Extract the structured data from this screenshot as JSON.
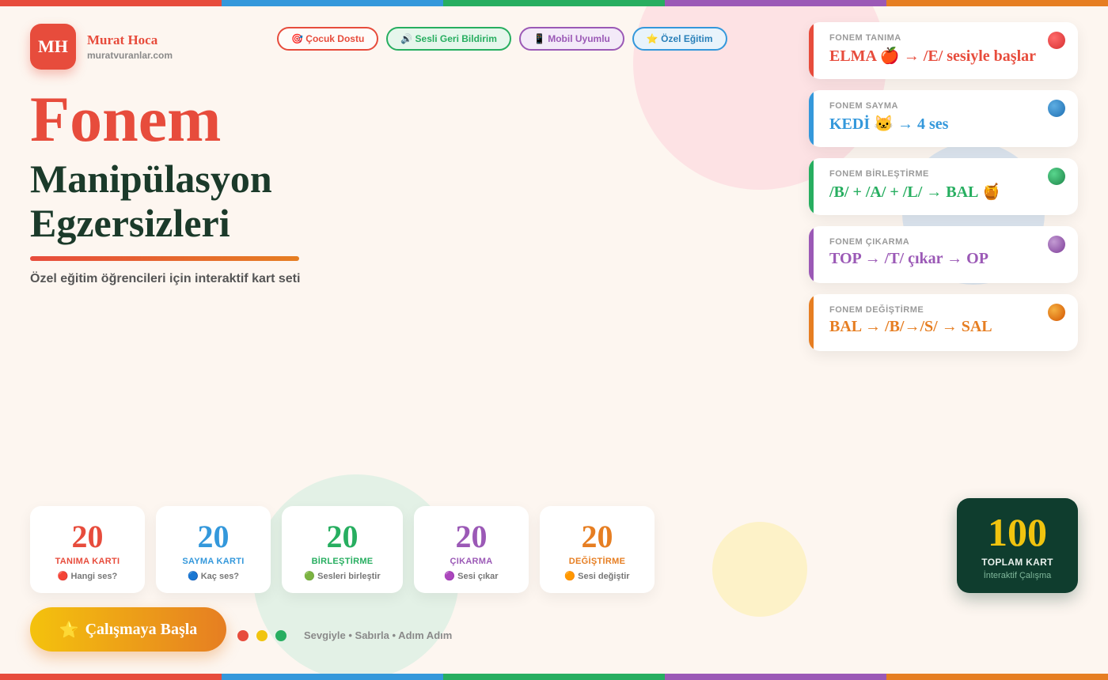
{
  "brand": {
    "initials": "MH",
    "name": "Murat Hoca",
    "site": "muratvuranlar.com"
  },
  "pills": [
    {
      "label": "🎯 Çocuk Dostu"
    },
    {
      "label": "🔊 Sesli Geri Bildirim"
    },
    {
      "label": "📱 Mobil Uyumlu"
    },
    {
      "label": "⭐ Özel Eğitim"
    }
  ],
  "hero": {
    "title": "Fonem",
    "subtitle_line1": "Manipülasyon",
    "subtitle_line2": "Egzersizleri",
    "description": "Özel eğitim öğrencileri için interaktif kart seti"
  },
  "feature_cards": [
    {
      "label": "FONEM TANIMA",
      "text": "ELMA 🍎 → /E/ sesiyle başlar",
      "icon": "red-circle-icon"
    },
    {
      "label": "FONEM SAYMA",
      "text": "KEDİ 🐱 → 4 ses",
      "icon": "blue-circle-icon"
    },
    {
      "label": "FONEM BİRLEŞTİRME",
      "text": "/B/ + /A/ + /L/ → BAL 🍯",
      "icon": "green-circle-icon"
    },
    {
      "label": "FONEM ÇIKARMA",
      "text": "TOP → /T/ çıkar → OP",
      "icon": "purple-circle-icon"
    },
    {
      "label": "FONEM DEĞİŞTİRME",
      "text": "BAL → /B/→/S/ → SAL",
      "icon": "orange-circle-icon"
    }
  ],
  "stats": [
    {
      "value": "20",
      "label": "TANIMA KARTI",
      "hint": "🔴 Hangi ses?"
    },
    {
      "value": "20",
      "label": "SAYMA KARTI",
      "hint": "🔵 Kaç ses?"
    },
    {
      "value": "20",
      "label": "BİRLEŞTİRME",
      "hint": "🟢 Sesleri birleştir"
    },
    {
      "value": "20",
      "label": "ÇIKARMA",
      "hint": "🟣 Sesi çıkar"
    },
    {
      "value": "20",
      "label": "DEĞİŞTİRME",
      "hint": "🟠 Sesi değiştir"
    }
  ],
  "total": {
    "value": "100",
    "label": "TOPLAM KART",
    "sub": "İnteraktif Çalışma"
  },
  "cta": {
    "icon": "⭐",
    "label": "Çalışmaya Başla"
  },
  "footer": {
    "text": "Sevgiyle • Sabırla • Adım Adım"
  },
  "colors": {
    "red": "#e74c3c",
    "blue": "#3498db",
    "green": "#27ae60",
    "purple": "#9b59b6",
    "orange": "#e67e22",
    "yellow": "#f1c40f",
    "dark_green": "#0f3d2e",
    "background": "#fdf6f0"
  }
}
